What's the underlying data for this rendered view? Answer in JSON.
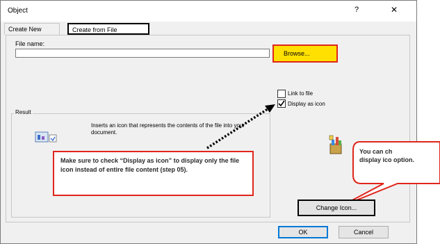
{
  "window": {
    "title": "Object",
    "help_glyph": "?",
    "close_glyph": "✕"
  },
  "tabs": [
    {
      "label": "Create New",
      "active": false
    },
    {
      "label": "Create from File",
      "active": true
    }
  ],
  "file": {
    "label": "File name:",
    "value": "",
    "browse_label": "Browse..."
  },
  "options": {
    "link_label": "Link to file",
    "link_checked": false,
    "display_label": "Display as icon",
    "display_checked": true
  },
  "result": {
    "legend": "Result",
    "text": "Inserts an icon that represents the contents of the file into your document."
  },
  "annotations": {
    "callout_main": "Make sure to check “Display as icon” to display only the file icon instead of entire file content (step 05).",
    "callout_side": "You can ch display ico option.",
    "highlight_color": "#ffe000",
    "annotation_color": "#e0251b"
  },
  "buttons": {
    "change_icon": "Change Icon...",
    "ok": "OK",
    "cancel": "Cancel"
  },
  "icons": {
    "file_icon": "file-preview-icon",
    "package_icon": "package-icon"
  }
}
